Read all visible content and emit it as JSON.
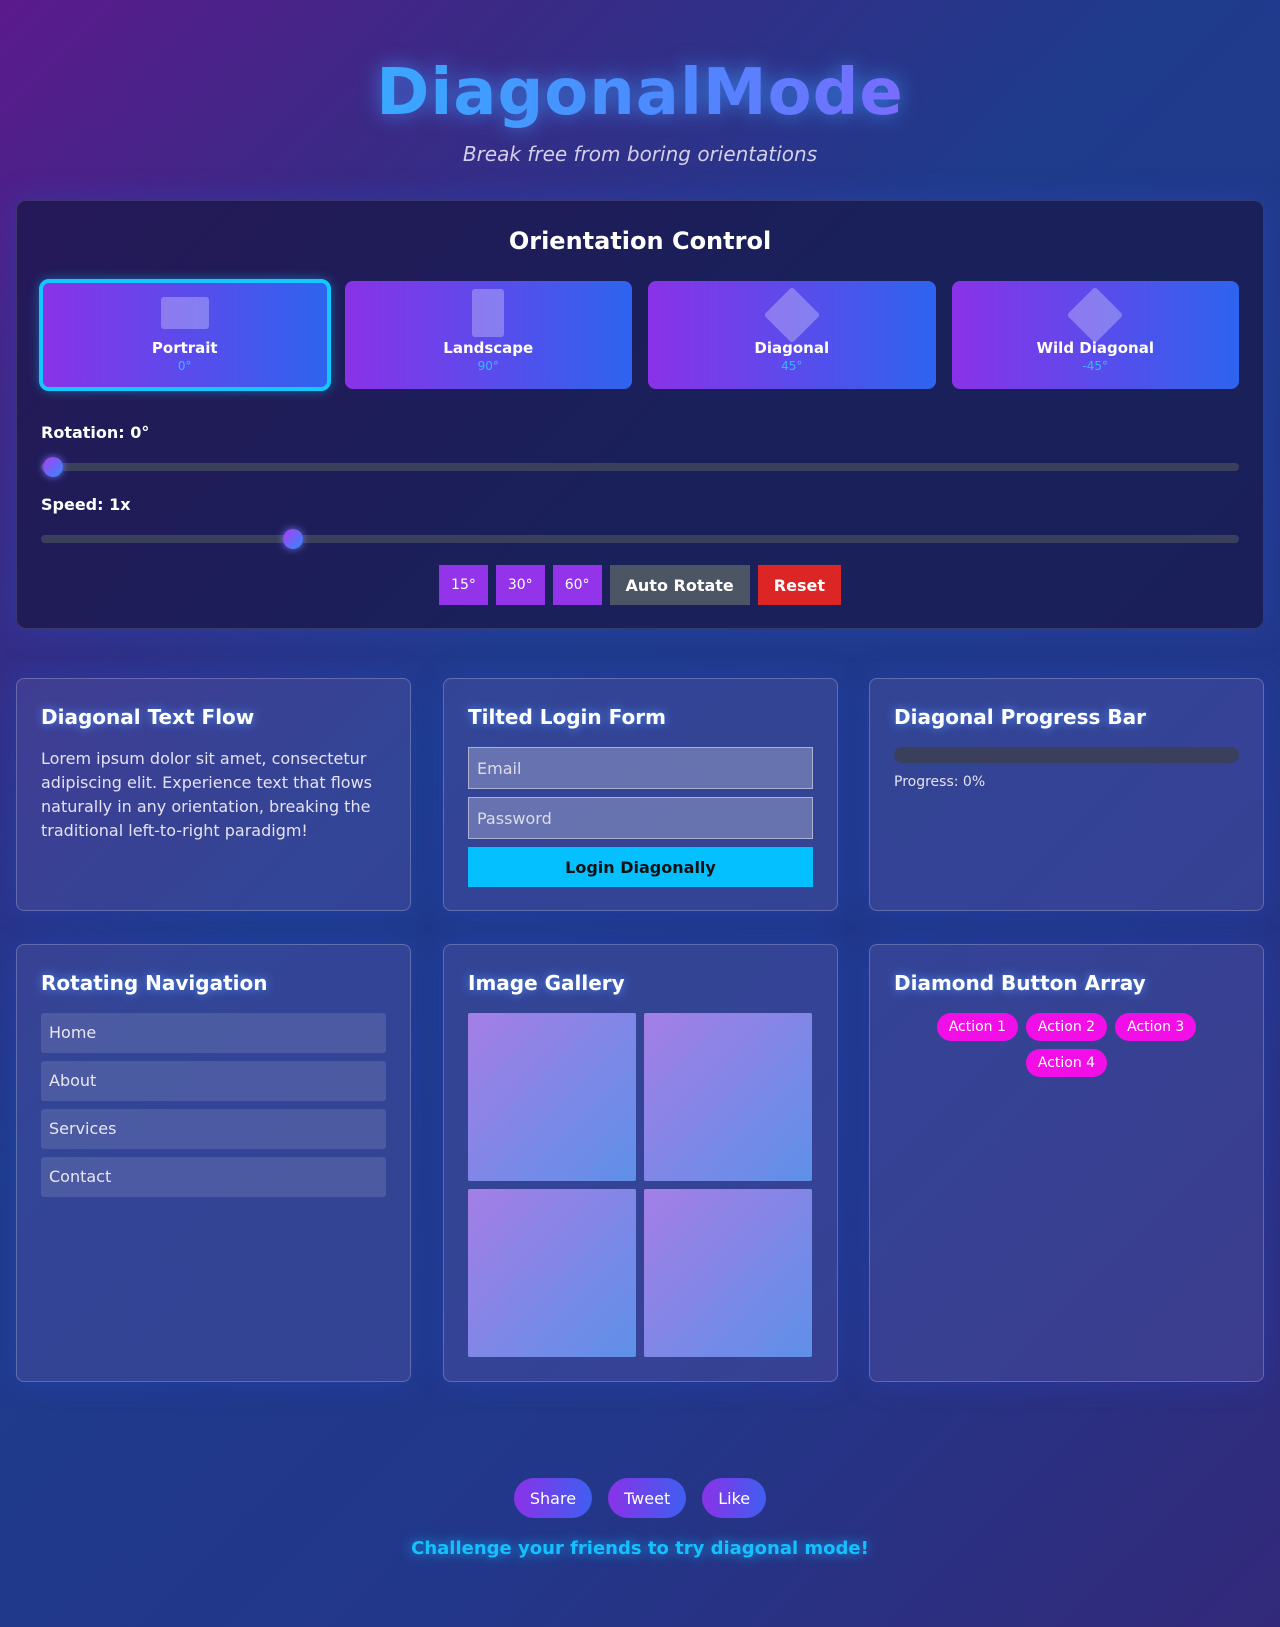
{
  "header": {
    "logo": "DiagonalMode",
    "tagline": "Break free from boring orientations"
  },
  "orientation_control": {
    "title": "Orientation Control",
    "modes": [
      {
        "label": "Portrait",
        "degrees": "0°",
        "active": true
      },
      {
        "label": "Landscape",
        "degrees": "90°",
        "active": false
      },
      {
        "label": "Diagonal",
        "degrees": "45°",
        "active": false
      },
      {
        "label": "Wild Diagonal",
        "degrees": "-45°",
        "active": false
      }
    ],
    "rotation_label": "Rotation: 0°",
    "rotation_value": 0,
    "speed_label": "Speed: 1x",
    "speed_value_fraction": 0.21,
    "buttons": {
      "deg15": "15°",
      "deg30": "30°",
      "deg60": "60°",
      "auto_rotate": "Auto Rotate",
      "reset": "Reset"
    }
  },
  "text_flow": {
    "title": "Diagonal Text Flow",
    "body": "Lorem ipsum dolor sit amet, consectetur adipiscing elit. Experience text that flows naturally in any orientation, breaking the traditional left-to-right paradigm!"
  },
  "login_form": {
    "title": "Tilted Login Form",
    "email_placeholder": "Email",
    "password_placeholder": "Password",
    "submit_label": "Login Diagonally"
  },
  "progress": {
    "title": "Diagonal Progress Bar",
    "value_percent": 0,
    "label": "Progress: 0%"
  },
  "navigation": {
    "title": "Rotating Navigation",
    "items": [
      "Home",
      "About",
      "Services",
      "Contact"
    ]
  },
  "gallery": {
    "title": "Image Gallery"
  },
  "diamond_buttons": {
    "title": "Diamond Button Array",
    "items": [
      "Action 1",
      "Action 2",
      "Action 3",
      "Action 4"
    ]
  },
  "footer": {
    "share": "Share",
    "tweet": "Tweet",
    "like": "Like",
    "challenge": "Challenge your friends to try diagonal mode!"
  }
}
